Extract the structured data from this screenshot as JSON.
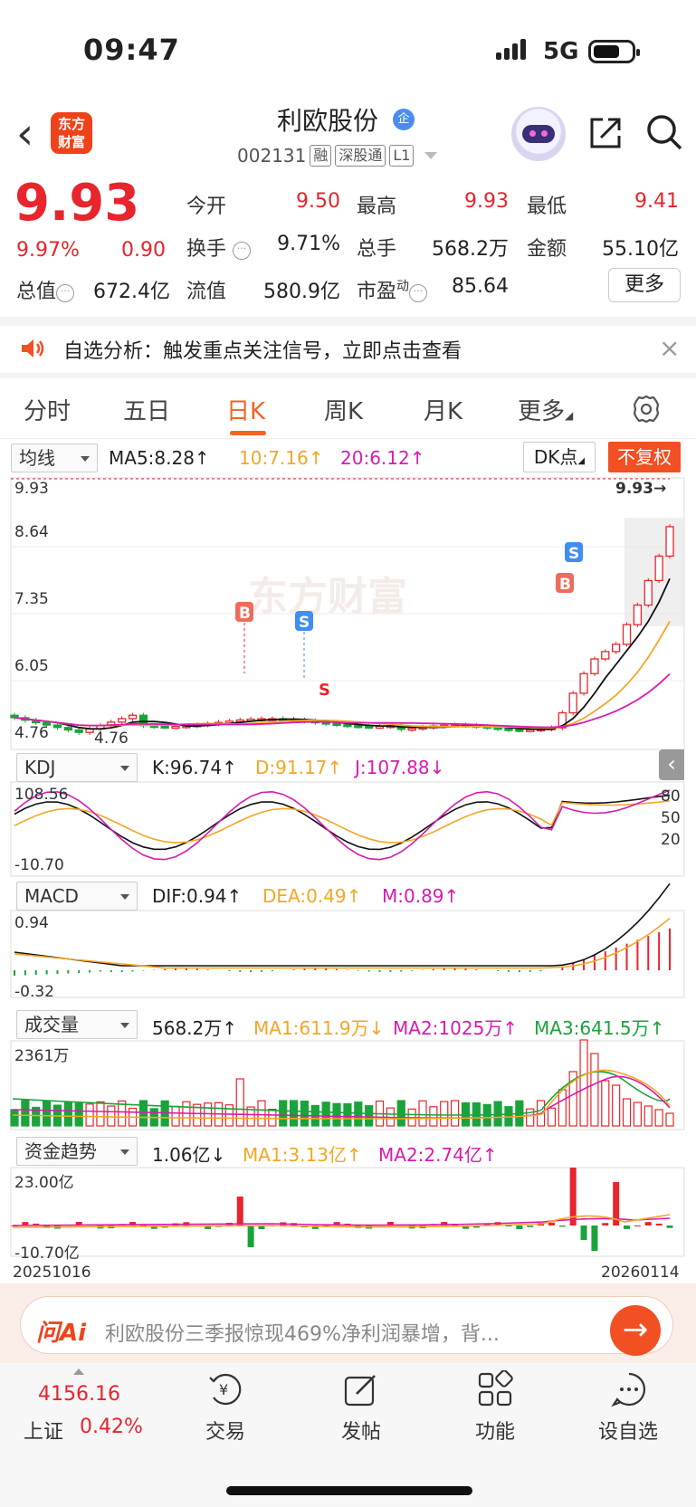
{
  "status": {
    "time": "09:47",
    "network": "5G"
  },
  "header": {
    "title": "利欧股份",
    "title_badge": "企",
    "code": "002131",
    "tags": [
      "融",
      "深股通",
      "L1"
    ],
    "logo_line1": "东方",
    "logo_line2": "财富"
  },
  "quote": {
    "price": "9.93",
    "change_pct": "9.97%",
    "change": "0.90",
    "open_label": "今开",
    "open": "9.50",
    "high_label": "最高",
    "high": "9.93",
    "low_label": "最低",
    "low": "9.41",
    "turnover_label": "换手",
    "turnover": "9.71%",
    "volume_label": "总手",
    "volume": "568.2万",
    "amount_label": "金额",
    "amount": "55.10亿",
    "mktcap_label": "总值",
    "mktcap": "672.4亿",
    "float_label": "流值",
    "float_cap": "580.9亿",
    "pe_label": "市盈",
    "pe_sup": "动",
    "pe": "85.64",
    "more_label": "更多"
  },
  "notice": {
    "text": "自选分析：触发重点关注信号，立即点击查看"
  },
  "tabs": {
    "items": [
      "分时",
      "五日",
      "日K",
      "周K",
      "月K",
      "更多"
    ],
    "active": "日K"
  },
  "kline": {
    "indicator": "均线",
    "ma5": "MA5:8.28↑",
    "ma10": "10:7.16↑",
    "ma20": "20:6.12↑",
    "dk_label": "DK点",
    "fuquan_label": "不复权",
    "y_labels": [
      "9.93",
      "8.64",
      "7.35",
      "6.05",
      "4.76"
    ],
    "max_marker": "9.93→",
    "min_marker": "4.76"
  },
  "kdj": {
    "indicator": "KDJ",
    "k": "K:96.74↑",
    "d": "D:91.17↑",
    "j": "J:107.88↓",
    "y_top": "108.56",
    "y_bottom": "-10.70",
    "levels": [
      "80",
      "50",
      "20"
    ]
  },
  "macd": {
    "indicator": "MACD",
    "dif": "DIF:0.94↑",
    "dea": "DEA:0.49↑",
    "m": "M:0.89↑",
    "y_top": "0.94",
    "y_bottom": "-0.32"
  },
  "vol": {
    "indicator": "成交量",
    "val": "568.2万↑",
    "ma1": "MA1:611.9万↓",
    "ma2": "MA2:1025万↑",
    "ma3": "MA3:641.5万↑",
    "y_top": "2361万"
  },
  "fund": {
    "indicator": "资金趋势",
    "val": "1.06亿↓",
    "ma1": "MA1:3.13亿↑",
    "ma2": "MA2:2.74亿↑",
    "y_top": "23.00亿",
    "y_bottom": "-10.70亿"
  },
  "dates": {
    "start": "20251016",
    "end": "20260114"
  },
  "ai": {
    "logo": "问Ai",
    "text": "利欧股份三季报惊现469%净利润暴增，背..."
  },
  "bottom_nav": {
    "index_value": "4156.16",
    "index_name": "上证",
    "index_pct": "0.42%",
    "items": [
      "交易",
      "发帖",
      "功能",
      "设自选"
    ]
  },
  "colors": {
    "up": "#e8242c",
    "down": "#1aa33a",
    "accent": "#f26522",
    "ma5": "#111111",
    "ma10": "#f5a623",
    "ma20": "#d81bb0"
  }
}
